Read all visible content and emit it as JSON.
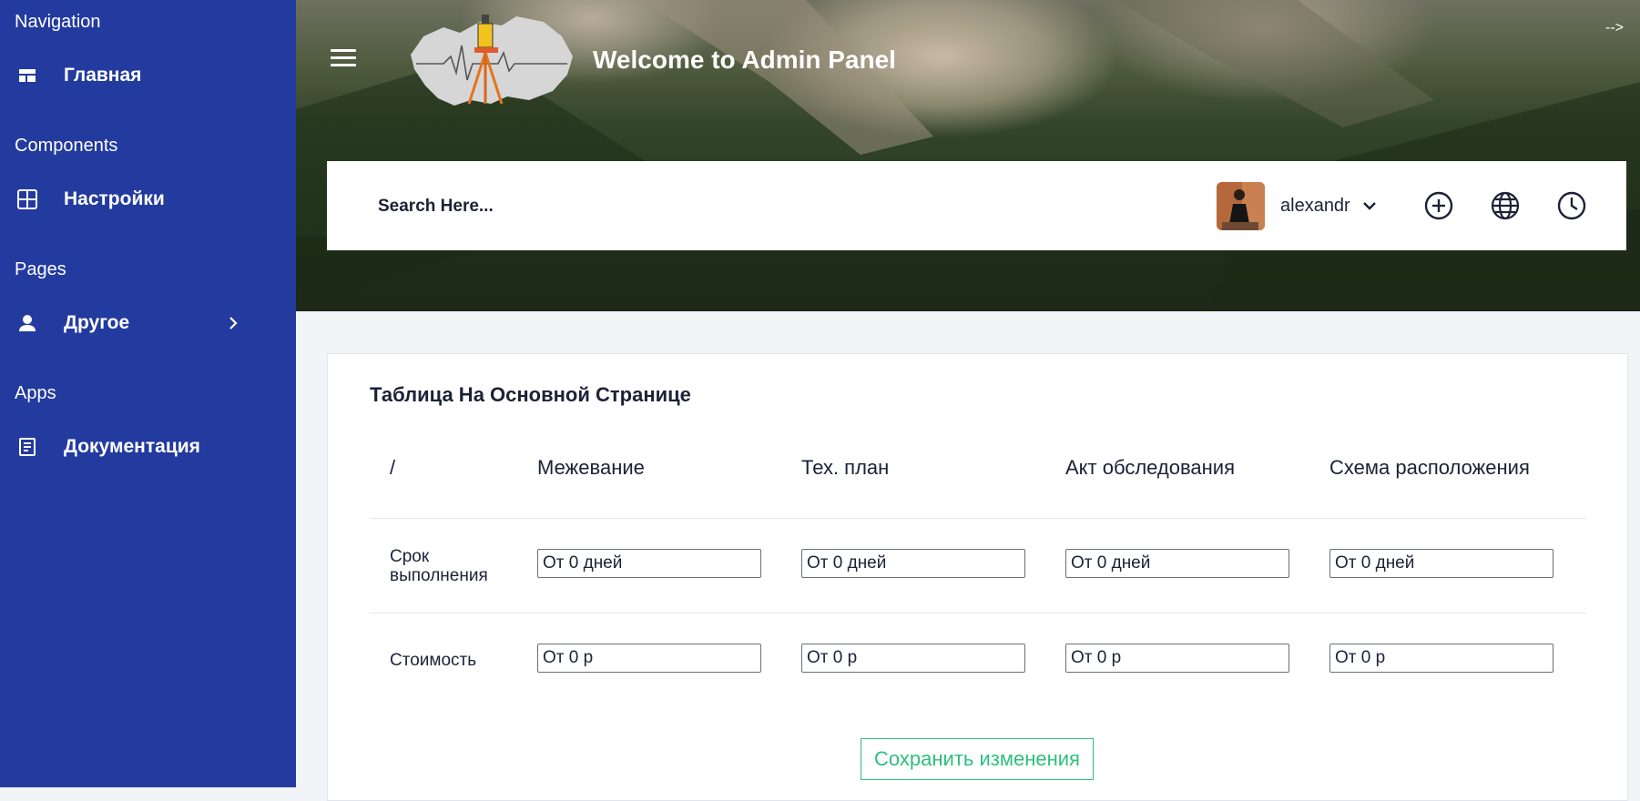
{
  "sidebar": {
    "sections": [
      {
        "title": "Navigation",
        "item": {
          "label": "Главная",
          "icon": "dashboard-icon"
        }
      },
      {
        "title": "Components",
        "item": {
          "label": "Настройки",
          "icon": "grid-icon"
        }
      },
      {
        "title": "Pages",
        "item": {
          "label": "Другое",
          "icon": "person-icon"
        }
      },
      {
        "title": "Apps",
        "item": {
          "label": "Документация",
          "icon": "document-icon"
        }
      }
    ]
  },
  "header": {
    "title": "Welcome to Admin Panel",
    "arrow_text": "-->"
  },
  "topbar": {
    "search_placeholder": "Search Here...",
    "username": "alexandr",
    "icons": [
      "add-circle-icon",
      "globe-icon",
      "clock-icon"
    ]
  },
  "card": {
    "title": "Таблица На Основной Странице",
    "columns": [
      "/",
      "Межевание",
      "Тех. план",
      "Акт обследования",
      "Схема расположения"
    ],
    "rows": [
      {
        "label": "Срок выполнения",
        "values": [
          "От 0 дней",
          "От 0 дней",
          "От 0 дней",
          "От 0 дней"
        ]
      },
      {
        "label": "Стоимость",
        "values": [
          "От 0 р",
          "От 0 р",
          "От 0 р",
          "От 0 р"
        ]
      }
    ],
    "save_label": "Сохранить изменения"
  },
  "colors": {
    "sidebar_bg": "#233a9e",
    "accent_green": "#2ebf7d",
    "text_dark": "#1c2236"
  }
}
